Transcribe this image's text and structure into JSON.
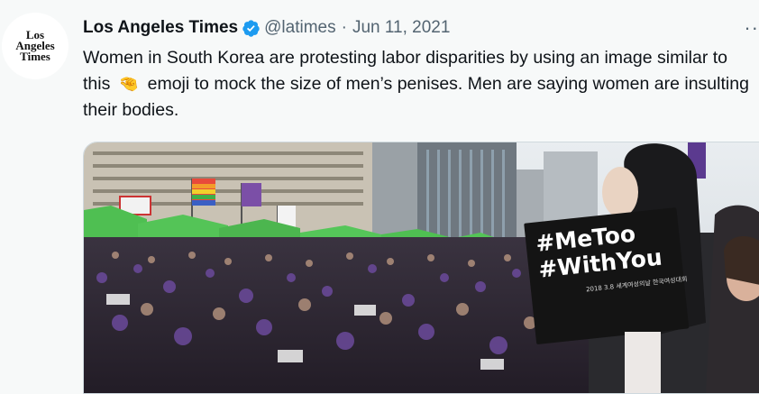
{
  "author": {
    "avatar_lines": [
      "Los",
      "Angeles",
      "Times"
    ],
    "name": "Los Angeles Times",
    "handle": "@latimes",
    "separator": "·",
    "date": "Jun 11, 2021",
    "verified_color": "#1d9bf0"
  },
  "more_label": "··",
  "tweet": {
    "text_before": "Women in South Korea are protesting labor disparities by using an image similar to this",
    "emoji": "🤏",
    "text_after": "emoji to mock the size of men’s penises. Men are saying women are insulting their bodies."
  },
  "media": {
    "sign_line1": "#MeToo",
    "sign_line2": "#WithYou",
    "sign_small": "2018 3.8 세계여성의날 한국여성대회"
  }
}
